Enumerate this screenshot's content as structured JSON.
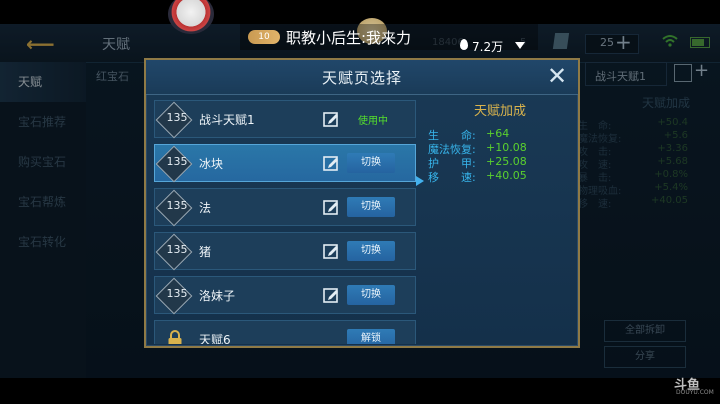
{
  "stream": {
    "badge": "10",
    "title": "职教小后生:我来力",
    "viewers": "7.2万"
  },
  "topbar": {
    "title": "天赋",
    "gold": "18406",
    "balance2": "5",
    "coin": "25"
  },
  "sidebar": {
    "items": [
      {
        "label": "天赋"
      },
      {
        "label": "宝石推荐"
      },
      {
        "label": "购买宝石"
      },
      {
        "label": "宝石帮炼"
      },
      {
        "label": "宝石转化"
      }
    ]
  },
  "gem_tab": "红宝石",
  "right_panel": {
    "page_name": "战斗天赋1",
    "title": "天赋加成",
    "rows": [
      {
        "k": "生　命:",
        "v": "+50.4"
      },
      {
        "k": "魔法恢复:",
        "v": "+5.6"
      },
      {
        "k": "攻　击:",
        "v": "+3.36"
      },
      {
        "k": "攻　速:",
        "v": "+5.68"
      },
      {
        "k": "暴　击:",
        "v": "+0.8%"
      },
      {
        "k": "物理吸血:",
        "v": "+5.4%"
      },
      {
        "k": "移　速:",
        "v": "+40.05"
      }
    ],
    "clear_all": "全部拆卸",
    "share": "分享"
  },
  "popup": {
    "title": "天赋页选择",
    "pages": [
      {
        "level": "135",
        "name": "战斗天赋1",
        "action": "使用中",
        "state": "using"
      },
      {
        "level": "135",
        "name": "冰块",
        "action": "切换",
        "state": "selected"
      },
      {
        "level": "135",
        "name": "法",
        "action": "切换",
        "state": "normal"
      },
      {
        "level": "135",
        "name": "猪",
        "action": "切换",
        "state": "normal"
      },
      {
        "level": "135",
        "name": "洛妹子",
        "action": "切换",
        "state": "normal"
      },
      {
        "level": "",
        "name": "天赋6",
        "action": "解锁",
        "state": "locked"
      }
    ],
    "bonus": {
      "title": "天赋加成",
      "stats": [
        {
          "k": "生　　命:",
          "v": "+64"
        },
        {
          "k": "魔法恢复:",
          "v": "+10.08"
        },
        {
          "k": "护　　甲:",
          "v": "+25.08"
        },
        {
          "k": "移　　速:",
          "v": "+40.05"
        }
      ]
    }
  },
  "watermark": "斗鱼",
  "watermark_sub": "DOUYU.COM"
}
